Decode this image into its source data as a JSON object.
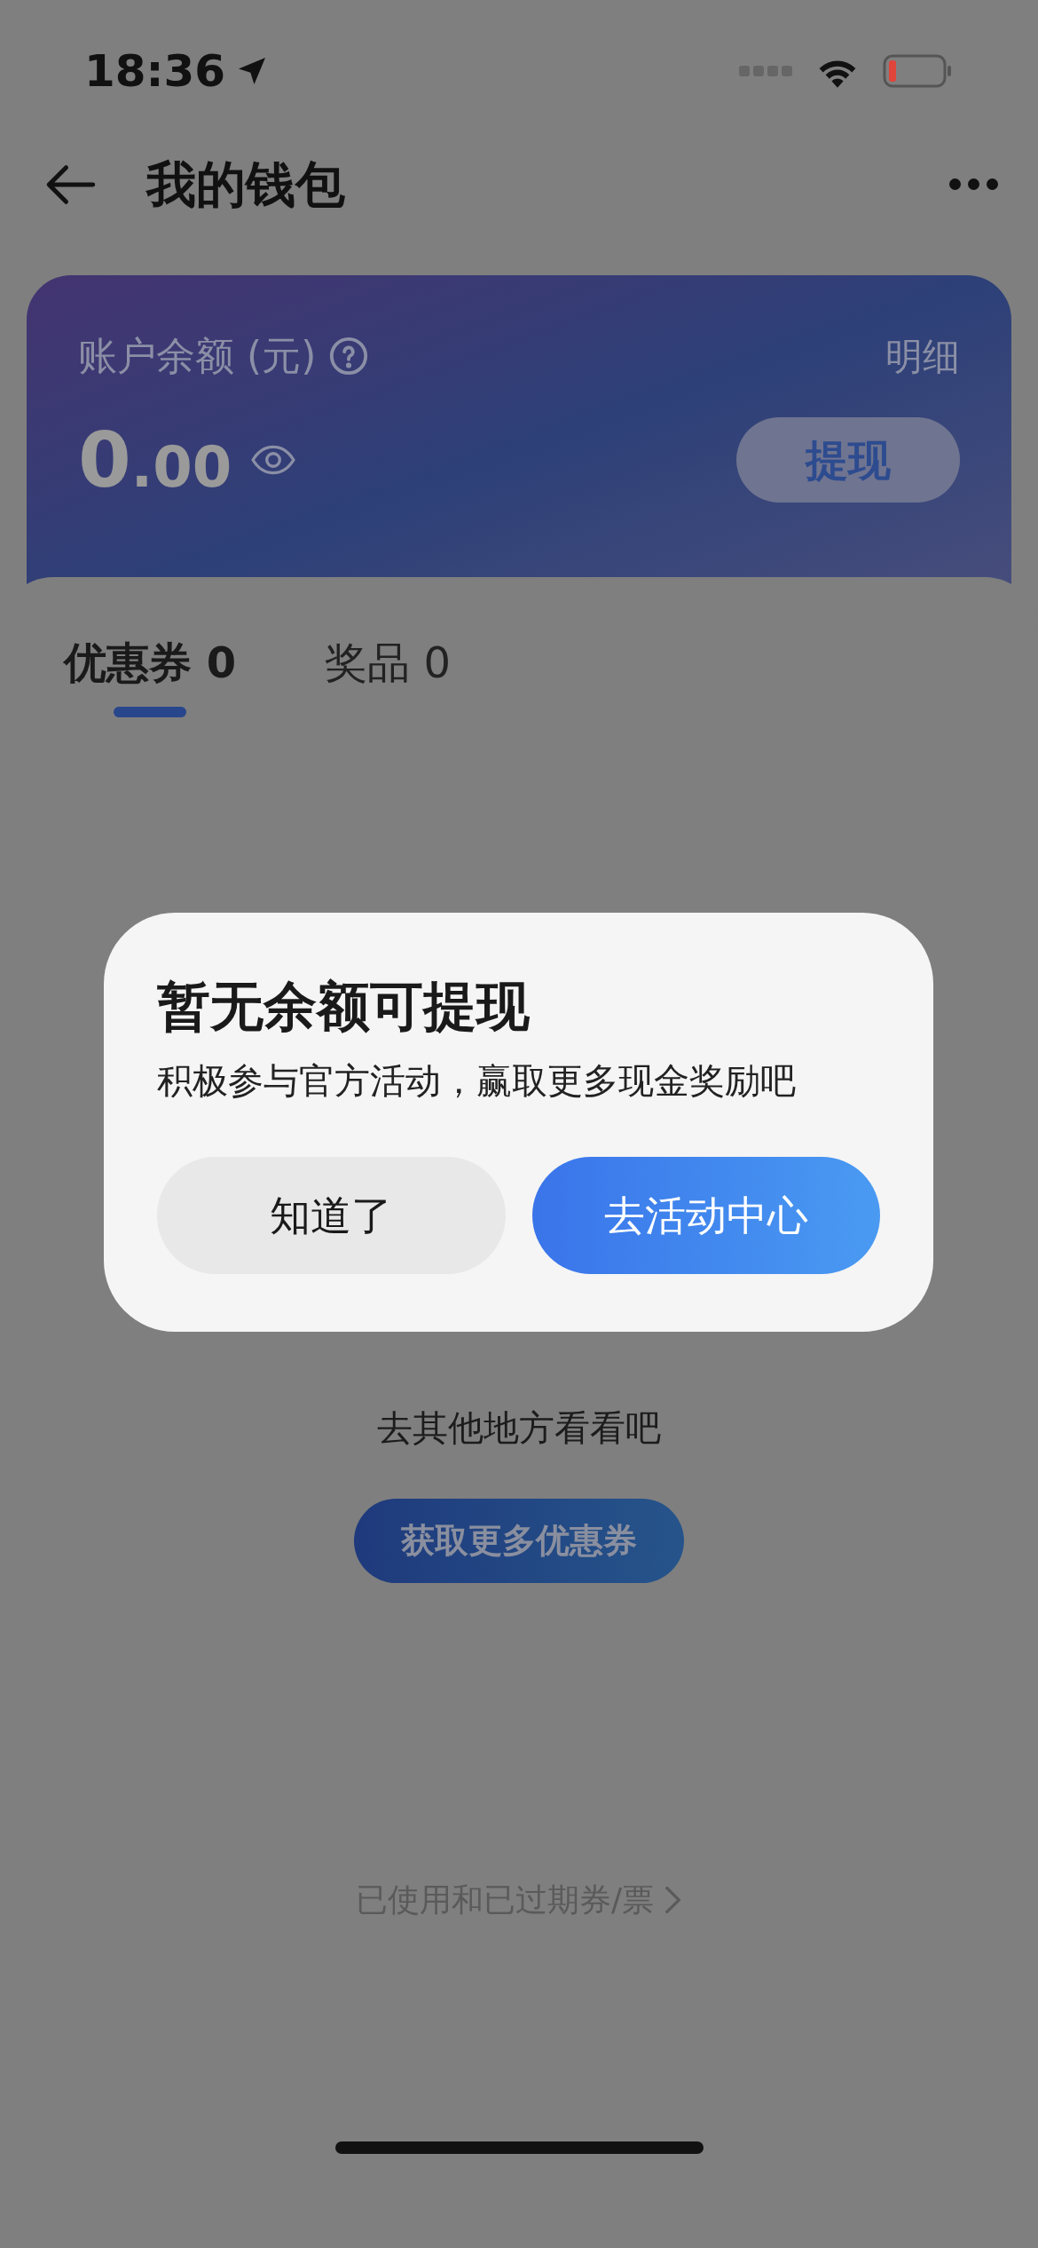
{
  "status_bar": {
    "time": "18:36"
  },
  "header": {
    "title": "我的钱包"
  },
  "balance_card": {
    "label": "账户余额 (元)",
    "detail_link": "明细",
    "amount": "0.00",
    "withdraw_button": "提现"
  },
  "tabs": [
    {
      "label": "优惠券",
      "count": "0",
      "selected": true
    },
    {
      "label": "奖品",
      "count": "0",
      "selected": false
    }
  ],
  "empty_state": {
    "subtitle": "去其他地方看看吧",
    "button": "获取更多优惠券"
  },
  "history_link": "已使用和已过期券/票",
  "dialog": {
    "title": "暂无余额可提现",
    "message": "积极参与官方活动，赢取更多现金奖励吧",
    "buttons": [
      {
        "label": "知道了",
        "kind": "secondary"
      },
      {
        "label": "去活动中心",
        "kind": "primary"
      }
    ]
  }
}
